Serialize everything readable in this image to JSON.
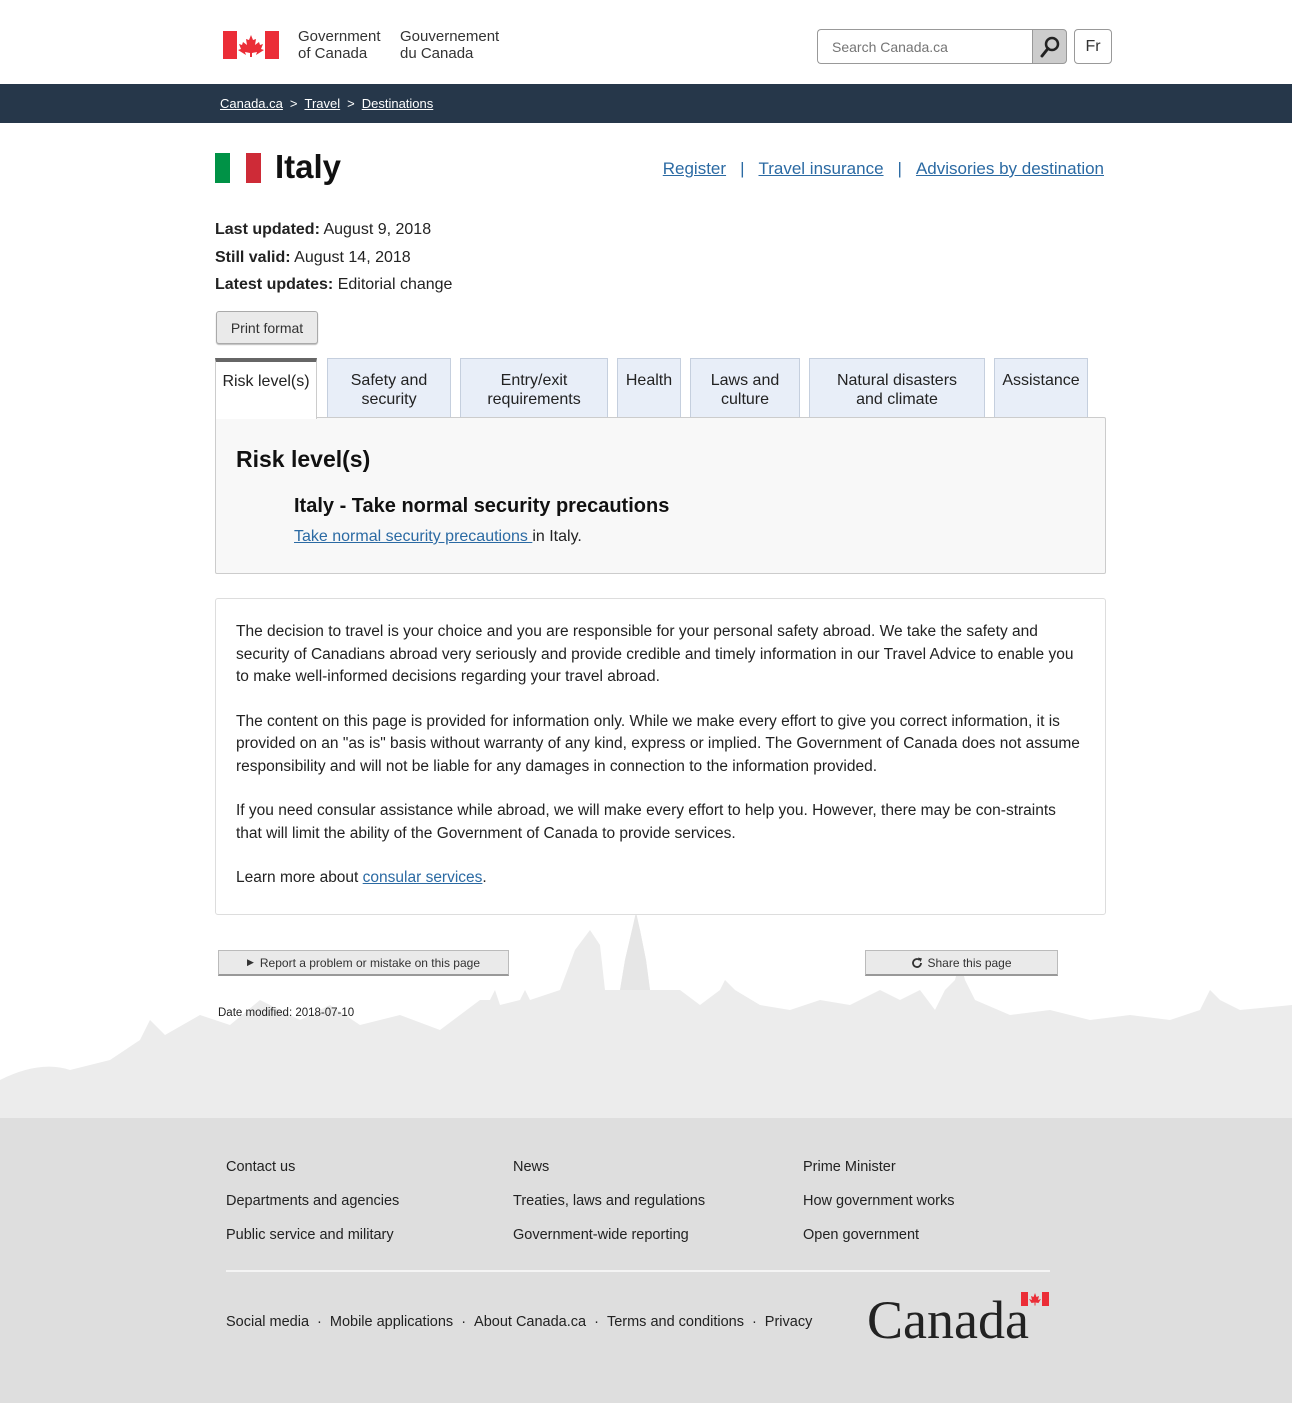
{
  "header": {
    "gov_en_line1": "Government",
    "gov_en_line2": "of Canada",
    "gov_fr_line1": "Gouvernement",
    "gov_fr_line2": "du Canada",
    "search_placeholder": "Search Canada.ca",
    "lang_label": "Fr"
  },
  "breadcrumb": {
    "items": [
      "Canada.ca",
      "Travel",
      "Destinations"
    ],
    "separator": ">"
  },
  "page": {
    "title": "Italy",
    "links": [
      "Register",
      "Travel insurance",
      "Advisories by destination"
    ],
    "link_separator": "|",
    "meta": [
      {
        "label": "Last updated:",
        "value": "August 9, 2018"
      },
      {
        "label": "Still valid:",
        "value": "August 14, 2018"
      },
      {
        "label": "Latest updates:",
        "value": "Editorial change"
      }
    ],
    "print_label": "Print format"
  },
  "tabs": [
    {
      "label": "Risk level(s)",
      "active": true
    },
    {
      "label": "Safety and security",
      "active": false
    },
    {
      "label": "Entry/exit requirements",
      "active": false
    },
    {
      "label": "Health",
      "active": false
    },
    {
      "label": "Laws and culture",
      "active": false
    },
    {
      "label": "Natural disasters and climate",
      "active": false
    },
    {
      "label": "Assistance",
      "active": false
    }
  ],
  "panel": {
    "heading": "Risk level(s)",
    "risk_title": "Italy - Take normal security precautions",
    "risk_link": "Take normal security precautions ",
    "risk_suffix": "in Italy."
  },
  "disclaimer": {
    "p1": "The decision to travel is your choice and you are responsible for your personal safety abroad. We take the safety and security of Canadians abroad very seriously and provide credible and timely information in our Travel Advice to enable you to make well-informed decisions regarding your travel abroad.",
    "p2": "The content on this page is provided for information only. While we make every effort to give you correct information, it is provided on an \"as is\" basis without warranty of any kind, express or implied. The Government of Canada does not assume responsibility and will not be liable for any damages in connection to the information provided.",
    "p3": "If you need consular assistance while abroad, we will make every effort to help you. However, there may be con-straints that will limit the ability of the Government of Canada to provide services.",
    "p4_prefix": "Learn more about ",
    "p4_link": "consular services",
    "p4_suffix": "."
  },
  "actions": {
    "report_label": "Report a problem or mistake on this page",
    "share_label": "Share this page",
    "date_modified": "Date modified: 2018-07-10"
  },
  "footer": {
    "col1": [
      "Contact us",
      "Departments and agencies",
      "Public service and military"
    ],
    "col2": [
      "News",
      "Treaties, laws and regulations",
      "Government-wide reporting"
    ],
    "col3": [
      "Prime Minister",
      "How government works",
      "Open government"
    ],
    "bottom_links": [
      "Social media",
      "Mobile applications",
      "About Canada.ca",
      "Terms and conditions",
      "Privacy"
    ],
    "bottom_separator": "·",
    "wordmark": "Canada"
  },
  "colors": {
    "crumbbar": "#26374a",
    "link": "#2b6aa3",
    "canada_red": "#eb2d37",
    "italy_green": "#009246",
    "italy_red": "#ce2b37",
    "footer_bg": "#dedede"
  }
}
